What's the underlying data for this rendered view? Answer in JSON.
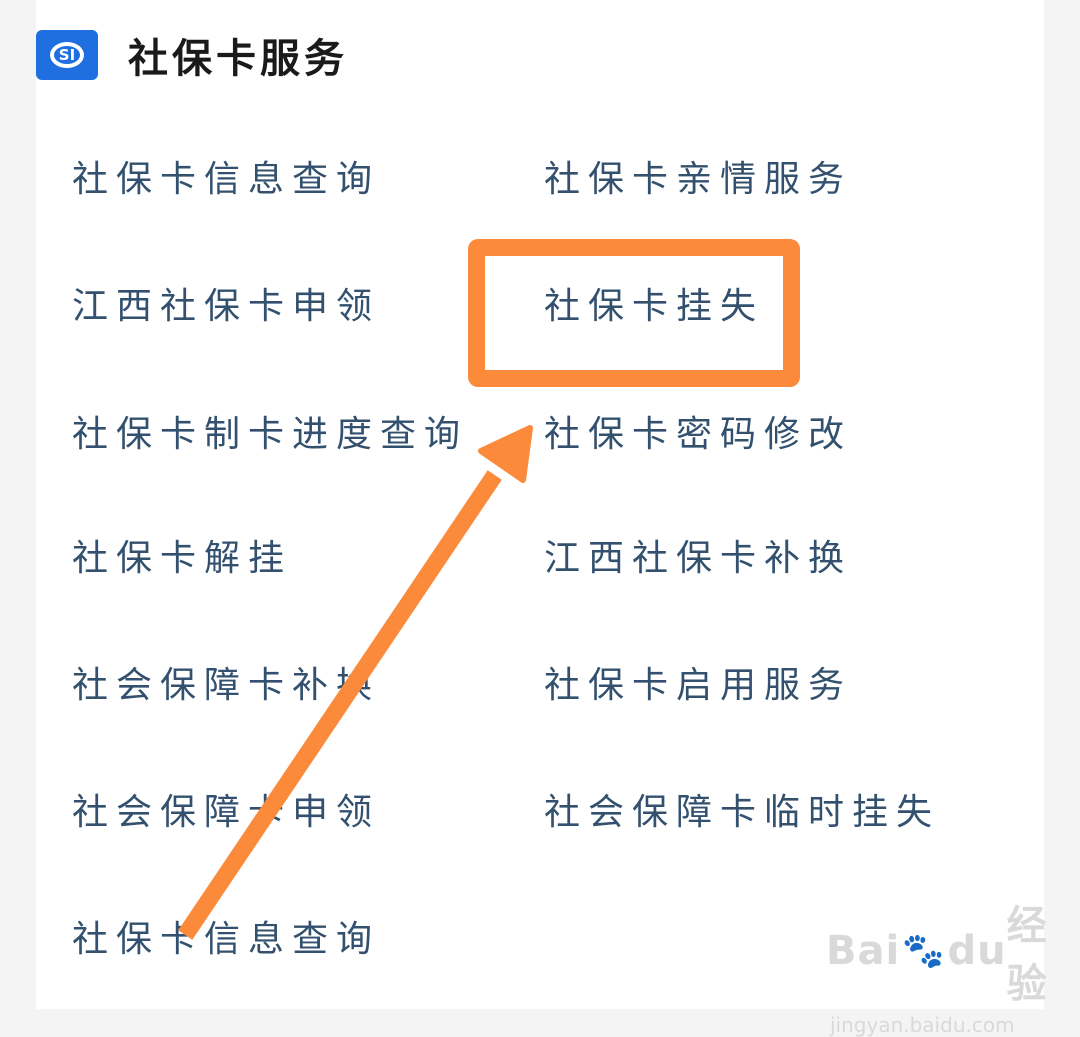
{
  "header": {
    "logo_text": "SI",
    "title": "社保卡服务"
  },
  "services": {
    "left": [
      "社保卡信息查询",
      "江西社保卡申领",
      "社保卡制卡进度查询",
      "社保卡解挂",
      "社会保障卡补换",
      "社会保障卡申领",
      "社保卡信息查询"
    ],
    "right": [
      "社保卡亲情服务",
      "社保卡挂失",
      "社保卡密码修改",
      "江西社保卡补换",
      "社保卡启用服务",
      "社会保障卡临时挂失"
    ]
  },
  "annotation": {
    "color": "#fb8a3b",
    "highlighted_item": "社保卡挂失"
  },
  "watermark": {
    "brand_left": "Bai",
    "brand_mid": "du",
    "brand_right": "经验",
    "url": "jingyan.baidu.com"
  },
  "colors": {
    "logo_blue": "#1f6fe0",
    "item_text": "#33516e",
    "background": "#f4f4f4"
  }
}
